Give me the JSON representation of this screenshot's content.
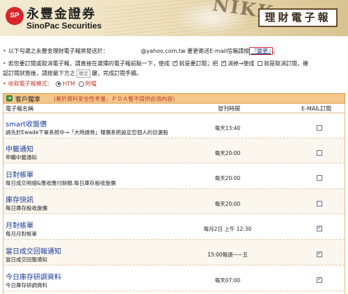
{
  "header": {
    "logo_mark": "SP",
    "logo_cn": "永豐金證券",
    "logo_en": "SinoPac Securities",
    "enews": "理財電子報",
    "background_text": "NIKK"
  },
  "info": {
    "line1_prefix": "以下勾選之永豐金理財電子報將發送於：",
    "line1_email": "@yahoo.com.tw",
    "line1_mid": "要更寄送E-mail信箱請按",
    "line1_link": "『變更』",
    "line1_end": "。",
    "line2_a": "若您要訂閱或取消電子報，請直接在選擇的電子報前點一下，使成",
    "line2_b": "就是要訂閱；把",
    "line2_c": "消掉→使成",
    "line2_d": "就是取消訂閱，確",
    "line3_a": "認訂閱狀態後，請按最下方之",
    "line3_input": "確定",
    "line3_b": "鍵，完成訂閱手續。",
    "line4_label": "收取電子報模式：",
    "line4_opt1": "HTM",
    "line4_opt2": "附檔"
  },
  "section": {
    "title": "客戶獨享",
    "note": "(基於資料安全性考量，ＰＤＡ暫不提供此項內容)",
    "col_name": "電子報名稱",
    "col_time": "發刊時間",
    "col_sub": "E-MAIL訂閱"
  },
  "rows": [
    {
      "name": "smart收盤價",
      "desc": "請先於Ewade下單系統中→「大時證券」報價系統設定您個人的自選股",
      "time": "每天13:40",
      "checked": false
    },
    {
      "name": "中籤通知",
      "desc": "申購中籤通知",
      "time": "每天20:00",
      "checked": false
    },
    {
      "name": "日對帳單",
      "desc": "每日成交明細&應收應付餘額.每日庫存股收盤價",
      "time": "每天20:00",
      "checked": false
    },
    {
      "name": "庫存快訊",
      "desc": "每日庫存股收盤價",
      "time": "每天20:00",
      "checked": false
    },
    {
      "name": "月對帳單",
      "desc": "每月月對帳單",
      "time": "每月2日 上午 12:30",
      "checked": true
    },
    {
      "name": "當日成交回報通知",
      "desc": "當日成交回報通知",
      "time": "15:00每週一~五",
      "checked": true
    },
    {
      "name": "今日庫存研調資料",
      "desc": "今日庫存研調資料",
      "time": "每天07:00",
      "checked": true
    }
  ]
}
